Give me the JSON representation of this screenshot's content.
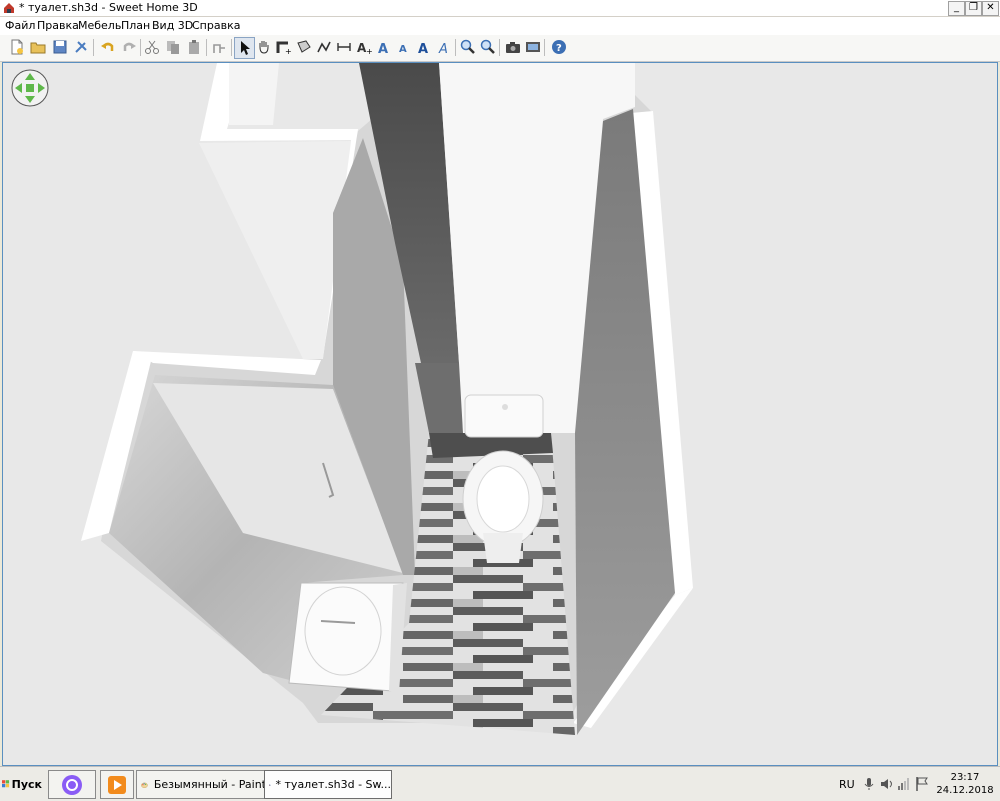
{
  "window": {
    "title": "* туалет.sh3d - Sweet Home 3D",
    "controls": [
      "minimize",
      "restore",
      "close"
    ]
  },
  "menu": {
    "items": [
      "Файл",
      "Правка",
      "Мебель",
      "План",
      "Вид 3D",
      "Справка"
    ]
  },
  "toolbar": {
    "buttons": [
      {
        "name": "new-home",
        "icon": "new-document-icon"
      },
      {
        "name": "open",
        "icon": "open-folder-icon"
      },
      {
        "name": "save",
        "icon": "save-icon"
      },
      {
        "name": "preferences",
        "icon": "preferences-icon"
      },
      {
        "name": "undo",
        "icon": "undo-icon"
      },
      {
        "name": "redo",
        "icon": "redo-icon"
      },
      {
        "name": "cut",
        "icon": "scissors-icon"
      },
      {
        "name": "copy",
        "icon": "copy-icon"
      },
      {
        "name": "paste",
        "icon": "paste-icon"
      },
      {
        "name": "add-furniture",
        "icon": "add-furniture-icon"
      },
      {
        "name": "select",
        "icon": "arrow-pointer-icon"
      },
      {
        "name": "pan",
        "icon": "hand-icon"
      },
      {
        "name": "create-walls",
        "icon": "create-walls-icon"
      },
      {
        "name": "create-rooms",
        "icon": "create-rooms-icon"
      },
      {
        "name": "create-polylines",
        "icon": "create-polylines-icon"
      },
      {
        "name": "create-dimensions",
        "icon": "create-dimensions-icon"
      },
      {
        "name": "add-text",
        "icon": "add-text-icon"
      },
      {
        "name": "increase-text",
        "icon": "text-increase-icon"
      },
      {
        "name": "decrease-text",
        "icon": "text-decrease-icon"
      },
      {
        "name": "bold-text",
        "icon": "text-bold-icon"
      },
      {
        "name": "italic-text",
        "icon": "text-italic-icon"
      },
      {
        "name": "zoom-in",
        "icon": "zoom-in-icon"
      },
      {
        "name": "zoom-out",
        "icon": "zoom-out-icon"
      },
      {
        "name": "create-photo",
        "icon": "camera-icon"
      },
      {
        "name": "create-video",
        "icon": "video-icon"
      },
      {
        "name": "help",
        "icon": "help-icon"
      }
    ]
  },
  "view3d": {
    "navigator_icon": "navigation-arrows-icon"
  },
  "taskbar": {
    "start_label": "Пуск",
    "tasks": [
      {
        "label": "",
        "icon": "alice-assistant-icon"
      },
      {
        "label": "",
        "icon": "media-player-icon"
      },
      {
        "label": "Безымянный - Paint",
        "icon": "paint-icon"
      },
      {
        "label": "* туалет.sh3d - Sw...",
        "icon": "sweet-home-3d-icon"
      }
    ],
    "tray": {
      "language": "RU",
      "time": "23:17",
      "date": "24.12.2018"
    }
  },
  "colors": {
    "view_background": "#e8e8e8",
    "wall_top": "#ffffff",
    "dark_tile": "#5c5c5c",
    "light_tile": "#e4e4e4",
    "accent": "#3c6fb4"
  }
}
